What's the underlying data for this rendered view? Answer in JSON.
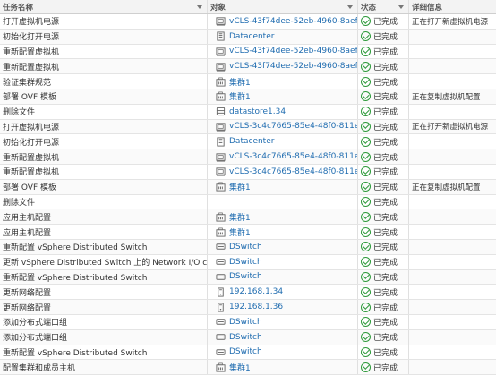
{
  "header": {
    "task_name": "任务名称",
    "object": "对象",
    "status": "状态",
    "details": "详细信息"
  },
  "icons": {
    "vm": "vm-icon",
    "datacenter": "datacenter-icon",
    "cluster": "cluster-icon",
    "datastore": "datastore-icon",
    "host": "host-icon",
    "dswitch": "dswitch-icon",
    "status_ok": "check-circle-icon"
  },
  "colors": {
    "link": "#1f6cb0",
    "ok": "#2e9a3b"
  },
  "rows": [
    {
      "task": "打开虚拟机电源",
      "icon": "vm",
      "object": "vCLS-43f74dee-52eb-4960-8aef-",
      "status": "已完成",
      "detail": "正在打开新虚拟机电源"
    },
    {
      "task": "初始化打开电源",
      "icon": "datacenter",
      "object": "Datacenter",
      "status": "已完成",
      "detail": ""
    },
    {
      "task": "重新配置虚拟机",
      "icon": "vm",
      "object": "vCLS-43f74dee-52eb-4960-8aef-",
      "status": "已完成",
      "detail": ""
    },
    {
      "task": "重新配置虚拟机",
      "icon": "vm",
      "object": "vCLS-43f74dee-52eb-4960-8aef-",
      "status": "已完成",
      "detail": ""
    },
    {
      "task": "验证集群规范",
      "icon": "cluster",
      "object": "集群1",
      "status": "已完成",
      "detail": ""
    },
    {
      "task": "部署 OVF 模板",
      "icon": "cluster",
      "object": "集群1",
      "status": "已完成",
      "detail": "正在复制虚拟机配置"
    },
    {
      "task": "删除文件",
      "icon": "datastore",
      "object": "datastore1.34",
      "status": "已完成",
      "detail": ""
    },
    {
      "task": "打开虚拟机电源",
      "icon": "vm",
      "object": "vCLS-3c4c7665-85e4-48f0-811e-",
      "status": "已完成",
      "detail": "正在打开新虚拟机电源"
    },
    {
      "task": "初始化打开电源",
      "icon": "datacenter",
      "object": "Datacenter",
      "status": "已完成",
      "detail": ""
    },
    {
      "task": "重新配置虚拟机",
      "icon": "vm",
      "object": "vCLS-3c4c7665-85e4-48f0-811e-",
      "status": "已完成",
      "detail": ""
    },
    {
      "task": "重新配置虚拟机",
      "icon": "vm",
      "object": "vCLS-3c4c7665-85e4-48f0-811e-",
      "status": "已完成",
      "detail": ""
    },
    {
      "task": "部署 OVF 模板",
      "icon": "cluster",
      "object": "集群1",
      "status": "已完成",
      "detail": "正在复制虚拟机配置"
    },
    {
      "task": "删除文件",
      "icon": "",
      "object": "",
      "status": "已完成",
      "detail": ""
    },
    {
      "task": "应用主机配置",
      "icon": "cluster",
      "object": "集群1",
      "status": "已完成",
      "detail": ""
    },
    {
      "task": "应用主机配置",
      "icon": "cluster",
      "object": "集群1",
      "status": "已完成",
      "detail": ""
    },
    {
      "task": "重新配置 vSphere Distributed Switch",
      "icon": "dswitch",
      "object": "DSwitch",
      "status": "已完成",
      "detail": ""
    },
    {
      "task": "更新 vSphere Distributed Switch 上的 Network I/O control",
      "icon": "dswitch",
      "object": "DSwitch",
      "status": "已完成",
      "detail": ""
    },
    {
      "task": "重新配置 vSphere Distributed Switch",
      "icon": "dswitch",
      "object": "DSwitch",
      "status": "已完成",
      "detail": ""
    },
    {
      "task": "更新网络配置",
      "icon": "host",
      "object": "192.168.1.34",
      "status": "已完成",
      "detail": ""
    },
    {
      "task": "更新网络配置",
      "icon": "host",
      "object": "192.168.1.36",
      "status": "已完成",
      "detail": ""
    },
    {
      "task": "添加分布式端口组",
      "icon": "dswitch",
      "object": "DSwitch",
      "status": "已完成",
      "detail": ""
    },
    {
      "task": "添加分布式端口组",
      "icon": "dswitch",
      "object": "DSwitch",
      "status": "已完成",
      "detail": ""
    },
    {
      "task": "重新配置 vSphere Distributed Switch",
      "icon": "dswitch",
      "object": "DSwitch",
      "status": "已完成",
      "detail": ""
    },
    {
      "task": "配置集群和成员主机",
      "icon": "cluster",
      "object": "集群1",
      "status": "已完成",
      "detail": ""
    }
  ]
}
